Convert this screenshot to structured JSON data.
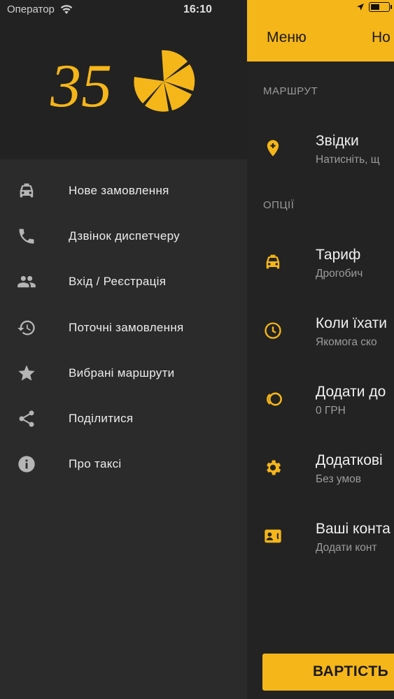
{
  "status_bar": {
    "carrier": "Оператор",
    "time": "16:10"
  },
  "logo": {
    "text": "35"
  },
  "drawer_menu": [
    {
      "icon": "taxi-icon",
      "label": "Нове замовлення"
    },
    {
      "icon": "phone-icon",
      "label": "Дзвінок диспетчеру"
    },
    {
      "icon": "people-icon",
      "label": "Вхід / Реєстрація"
    },
    {
      "icon": "history-icon",
      "label": "Поточні замовлення"
    },
    {
      "icon": "star-icon",
      "label": "Вибрані маршрути"
    },
    {
      "icon": "share-icon",
      "label": "Поділитися"
    },
    {
      "icon": "info-icon",
      "label": "Про таксі"
    }
  ],
  "header": {
    "menu_label": "Меню",
    "title": "Но"
  },
  "sections": {
    "route": "МАРШРУТ",
    "options": "ОПЦІЇ"
  },
  "route_rows": [
    {
      "icon": "add-location-icon",
      "title": "Звідки",
      "subtitle": "Натисніть, щ"
    }
  ],
  "option_rows": [
    {
      "icon": "taxi-icon",
      "title": "Тариф",
      "subtitle": "Дрогобич"
    },
    {
      "icon": "clock-icon",
      "title": "Коли їхати",
      "subtitle": "Якомога ско"
    },
    {
      "icon": "coins-icon",
      "title": "Додати до",
      "subtitle": "0 ГРН"
    },
    {
      "icon": "gear-icon",
      "title": "Додаткові",
      "subtitle": "Без умов"
    },
    {
      "icon": "contact-icon",
      "title": "Ваші конта",
      "subtitle": "Додати конт"
    }
  ],
  "price_button": {
    "label": "ВАРТІСТЬ"
  },
  "colors": {
    "accent": "#F5B61A",
    "drawer_bg": "#2B2B2B",
    "main_bg": "#232323",
    "icon_grey": "#B5B5B5"
  }
}
